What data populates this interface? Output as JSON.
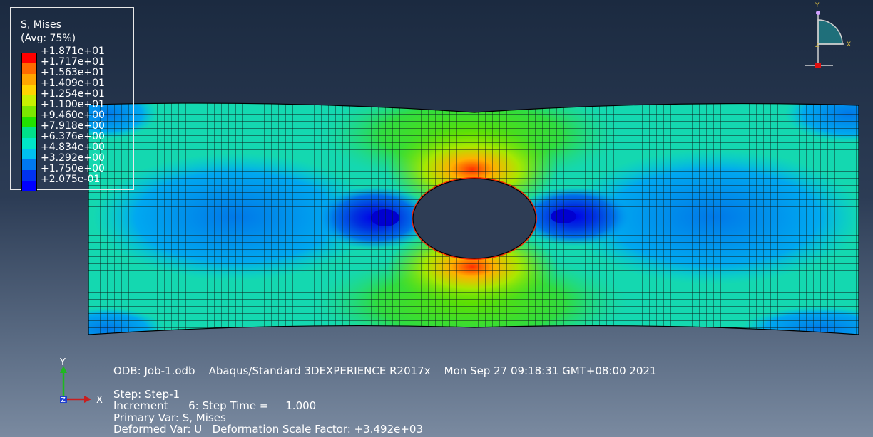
{
  "legend": {
    "title": "S, Mises",
    "avg": "(Avg: 75%)",
    "colors": [
      "#ff0000",
      "#ff6a00",
      "#ffa500",
      "#ffd400",
      "#c8f000",
      "#7ce600",
      "#22e000",
      "#00e08a",
      "#00e6c8",
      "#00c0f0",
      "#0078f0",
      "#0032f0",
      "#0000ff"
    ],
    "values": [
      "+1.871e+01",
      "+1.717e+01",
      "+1.563e+01",
      "+1.409e+01",
      "+1.254e+01",
      "+1.100e+01",
      "+9.460e+00",
      "+7.918e+00",
      "+6.376e+00",
      "+4.834e+00",
      "+3.292e+00",
      "+1.750e+00",
      "+2.075e-01"
    ]
  },
  "info": {
    "odb_line": "ODB: Job-1.odb    Abaqus/Standard 3DEXPERIENCE R2017x    Mon Sep 27 09:18:31 GMT+08:00 2021",
    "step_line": "Step: Step-1",
    "increment_line": "Increment      6: Step Time =     1.000",
    "primary_line": "Primary Var: S, Mises",
    "deformed_line": "Deformed Var: U   Deformation Scale Factor: +3.492e+03"
  },
  "triad": {
    "y": "Y",
    "x": "X",
    "z": "Z"
  },
  "view_cube": {
    "y": "Y",
    "x": "X",
    "z": "Z"
  }
}
